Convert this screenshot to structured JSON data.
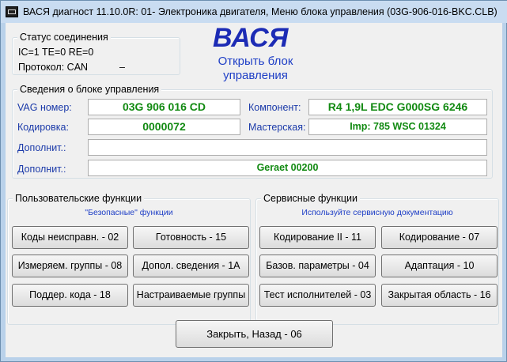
{
  "window": {
    "title": "ВАСЯ диагност 11.10.0R: 01- Электроника двигателя,  Меню блока управления (03G-906-016-BKC.CLB)"
  },
  "connection": {
    "legend": "Статус соединения",
    "status_line": "IC=1  TE=0   RE=0",
    "protocol_label": "Протокол: CAN",
    "protocol_extra": "–"
  },
  "logo": {
    "text": "ВАСЯ",
    "subtitle": "Открыть блок управления"
  },
  "ecu_info": {
    "legend": "Сведения о блоке управления",
    "vag_label": "VAG номер:",
    "vag_value": "03G 906 016 CD",
    "component_label": "Компонент:",
    "component_value": "R4 1,9L EDC G000SG  6246",
    "coding_label": "Кодировка:",
    "coding_value": "0000072",
    "workshop_label": "Мастерская:",
    "workshop_value": "Imp: 785     WSC 01324",
    "extra1_label": "Дополнит.:",
    "extra1_value": "",
    "extra2_label": "Дополнит.:",
    "extra2_value": "Geraet 00200"
  },
  "user_functions": {
    "legend": "Пользовательские функции",
    "subtitle": "\"Безопасные\" функции",
    "buttons": [
      "Коды неисправн. - 02",
      "Готовность - 15",
      "Измеряем. группы - 08",
      "Допол. сведения - 1А",
      "Поддер. кода - 18",
      "Настраиваемые группы"
    ]
  },
  "service_functions": {
    "legend": "Сервисные функции",
    "subtitle": "Используйте сервисную документацию",
    "buttons": [
      "Кодирование II - 11",
      "Кодирование - 07",
      "Базов. параметры - 04",
      "Адаптация - 10",
      "Тест исполнителей - 03",
      "Закрытая область - 16"
    ]
  },
  "close_button": "Закрыть, Назад - 06",
  "colors": {
    "frame": "#b9d1ea",
    "client_bg": "#f0f0f0",
    "value_green": "#128a12",
    "logo_blue": "#1c2bb5",
    "label_blue": "#1b3aa9"
  },
  "icons": {
    "window_icon": "monitor-icon"
  }
}
